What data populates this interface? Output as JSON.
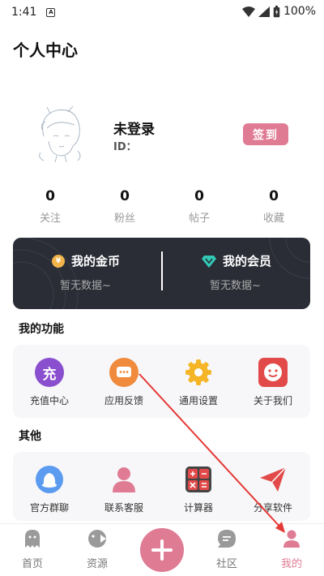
{
  "status_bar": {
    "time": "1:41",
    "battery": "100%"
  },
  "page": {
    "title": "个人中心"
  },
  "profile": {
    "name": "未登录",
    "id_label": "ID：",
    "signin_label": "签到"
  },
  "stats": [
    {
      "value": "0",
      "label": "关注"
    },
    {
      "value": "0",
      "label": "粉丝"
    },
    {
      "value": "0",
      "label": "帖子"
    },
    {
      "value": "0",
      "label": "收藏"
    }
  ],
  "wallet": {
    "coins": {
      "label": "我的金币",
      "value": "暂无数据~"
    },
    "vip": {
      "label": "我的会员",
      "value": "暂无数据~"
    }
  },
  "features": {
    "title": "我的功能",
    "items": [
      {
        "label": "充值中心",
        "icon": "recharge-icon",
        "glyph": "充"
      },
      {
        "label": "应用反馈",
        "icon": "feedback-icon"
      },
      {
        "label": "通用设置",
        "icon": "settings-icon"
      },
      {
        "label": "关于我们",
        "icon": "about-icon"
      }
    ]
  },
  "others": {
    "title": "其他",
    "items": [
      {
        "label": "官方群聊",
        "icon": "group-chat-icon"
      },
      {
        "label": "联系客服",
        "icon": "customer-service-icon"
      },
      {
        "label": "计算器",
        "icon": "calculator-icon"
      },
      {
        "label": "分享软件",
        "icon": "share-icon"
      }
    ]
  },
  "nav": [
    {
      "label": "首页",
      "icon": "ghost-icon"
    },
    {
      "label": "资源",
      "icon": "gamepad-icon"
    },
    {
      "label": "社区",
      "icon": "chat-bubble-icon"
    },
    {
      "label": "我的",
      "icon": "user-icon",
      "active": true
    }
  ],
  "colors": {
    "accent": "#e07b94",
    "wallet_bg": "#2a2d35",
    "annotation": "#e53935"
  }
}
